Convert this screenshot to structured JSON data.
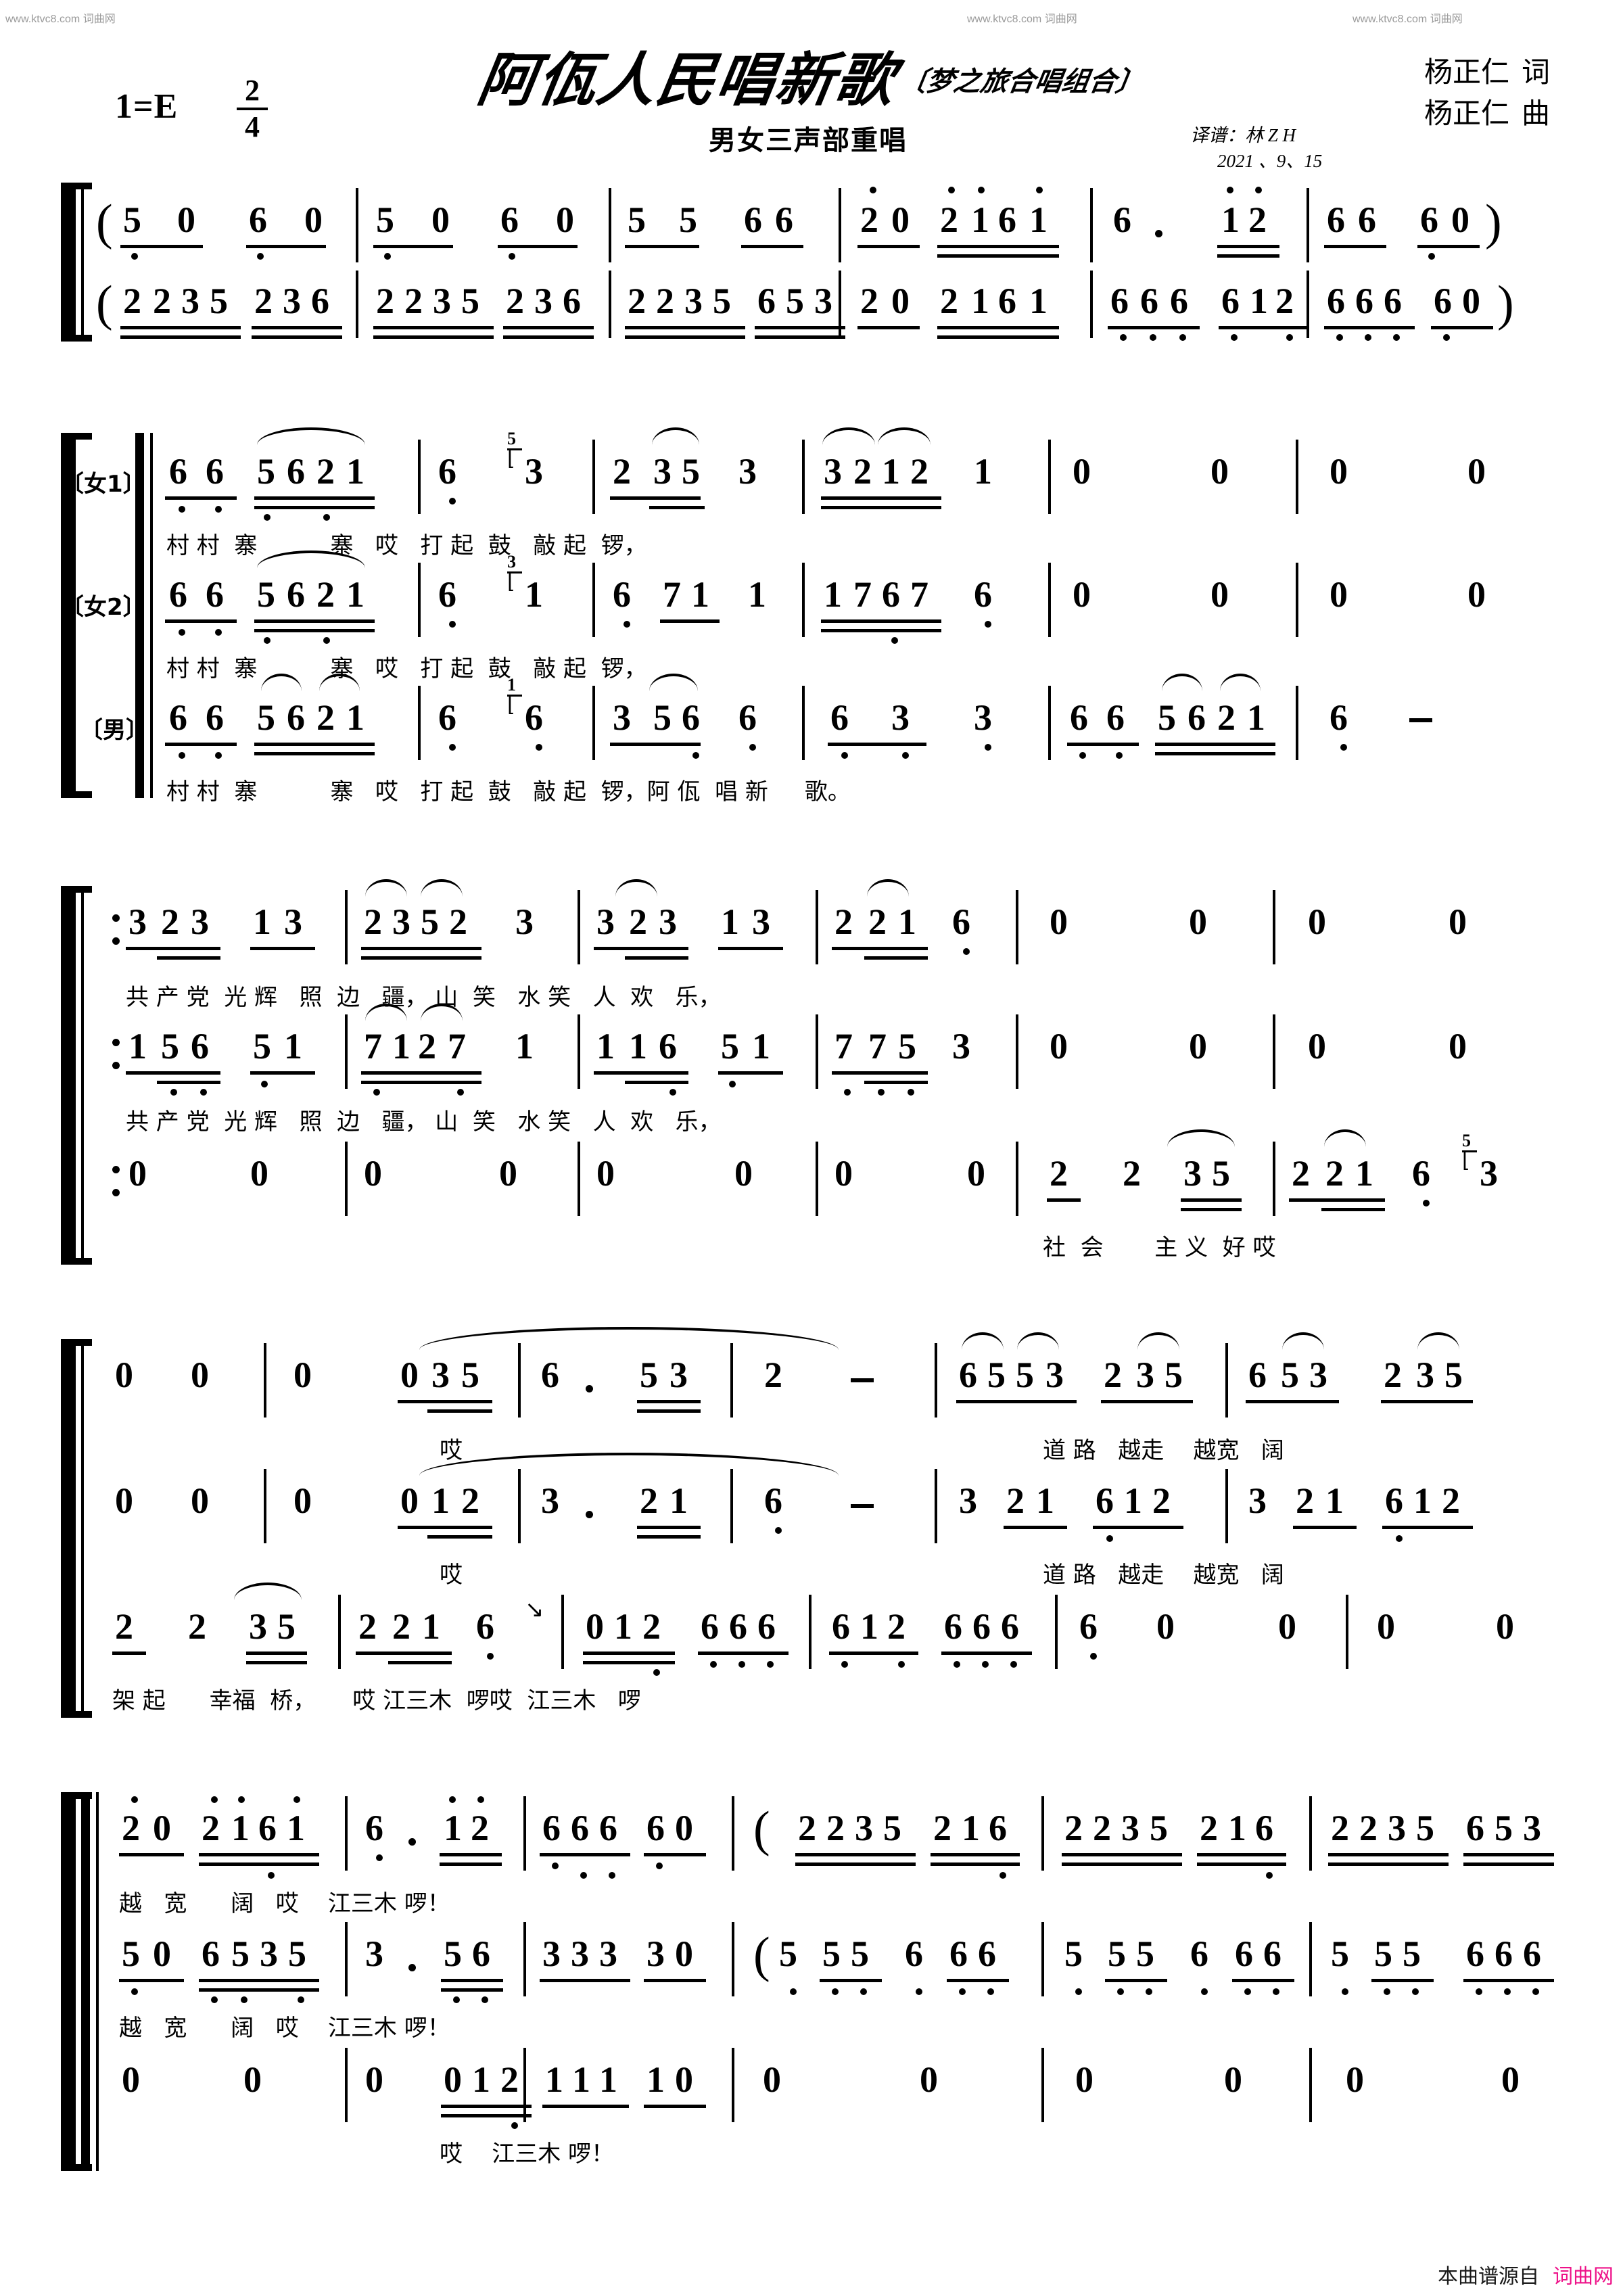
{
  "watermarks": {
    "top_left": "www.ktvc8.com 词曲网",
    "top_center": "www.ktvc8.com 词曲网",
    "top_right": "www.ktvc8.com 词曲网",
    "footer_black": "本曲谱源自",
    "footer_pink": "词曲网"
  },
  "header": {
    "key_signature": "1=E",
    "time_sig_num": "2",
    "time_sig_den": "4",
    "title": "阿佤人民唱新歌",
    "title_paren": "〔梦之旅合唱组合〕",
    "subtitle": "男女三声部重唱",
    "lyricist": "杨正仁",
    "lyricist_role": "词",
    "composer": "杨正仁",
    "composer_role": "曲",
    "transcriber": "译谱：林 Z H",
    "date": "2021 、9、15"
  },
  "voice_labels": {
    "soprano": "〔女1〕",
    "alto": "〔女2〕",
    "male": "〔男〕"
  },
  "chart_data": {
    "type": "table",
    "title": "阿佤人民唱新歌 — 简谱 (jianpu numbered notation)",
    "systems": [
      {
        "name": "intro",
        "parts": [
          {
            "name": "upper",
            "notes": "(5 0 6 0 | 5 0 6 0 | 5 5 66 | 20 2161 | 6 · 12 | 66 60 )"
          },
          {
            "name": "lower",
            "notes": "(2235 236 | 2235 236 | 2235 653 | 20 2161 | 666 612 | 666 60 )"
          }
        ]
      },
      {
        "name": "verse-a",
        "parts": [
          {
            "name": "soprano",
            "notes": "66 5621 | 6 (5)3 | 2 35 3 | 3212 1 | 0 0 | 0 0",
            "lyrics": "村村寨寨哎打起鼓敲起锣，"
          },
          {
            "name": "alto",
            "notes": "66 5621 | 6 (3)1 | 6 71 1 | 1767 6 | 0 0 | 0 0",
            "lyrics": "村村寨寨哎打起鼓敲起锣，"
          },
          {
            "name": "male",
            "notes": "66 5621 | 6 (1)6 | 3 56 6 | 6 3 3 | 66 5621 | 6 -",
            "lyrics": "村村寨寨哎打起鼓敲起锣，阿佤唱新歌。"
          }
        ]
      },
      {
        "name": "verse-b",
        "parts": [
          {
            "name": "soprano",
            "notes": ":3 23 1 3 | 2352 3 | 3 23 1 3 | 2 21 6 | 0 0 | 0 0",
            "lyrics": "共产党光辉照边疆，山笑水笑人欢乐，"
          },
          {
            "name": "alto",
            "notes": ":1 56 5 1 | 7127 1 | 1 16 5 1 | 7 75 3 | 0 0 | 0 0",
            "lyrics": "共产党光辉照边疆，山笑水笑人欢乐，"
          },
          {
            "name": "male",
            "notes": ":0 0 | 0 0 | 0 0 | 0 0 | 2 2 35 | 2 21 6(5)3",
            "lyrics": "社会主义好哎"
          }
        ]
      },
      {
        "name": "verse-c",
        "parts": [
          {
            "name": "soprano",
            "notes": "0 0 | 0 0 35 | 6 · 53 | 2 - | 6553 235 | 6 53 235",
            "lyrics": "哎道路越走越宽阔"
          },
          {
            "name": "alto",
            "notes": "0 0 | 0 0 12 | 3 · 21 | 6 - | 3 21 612 | 3 21 612",
            "lyrics": "哎道路越走越宽阔"
          },
          {
            "name": "male",
            "notes": "2 2 35 | 2 21 6 | 012 666 | 612 666 | 6 0 0 | 0 0",
            "lyrics": "架起幸福桥，哎江三木啰哎江三木啰"
          }
        ]
      },
      {
        "name": "coda",
        "parts": [
          {
            "name": "soprano",
            "notes": "20 2161 | 6 · 12 | 666 60 | ( 2235 216 | 2235 216 | 2235 653",
            "lyrics": "越宽阔哎江三木啰！"
          },
          {
            "name": "alto",
            "notes": "50 6535 | 3 · 56 | 333 30 | (5 55 6 66 | 5 55 6 66 | 5 55 666",
            "lyrics": "越宽阔哎江三木啰！"
          },
          {
            "name": "male",
            "notes": "0 0 | 0 012 | 111 10 | 0 0 | 0 0 | 0 0",
            "lyrics": "哎江三木啰！"
          }
        ]
      }
    ]
  }
}
